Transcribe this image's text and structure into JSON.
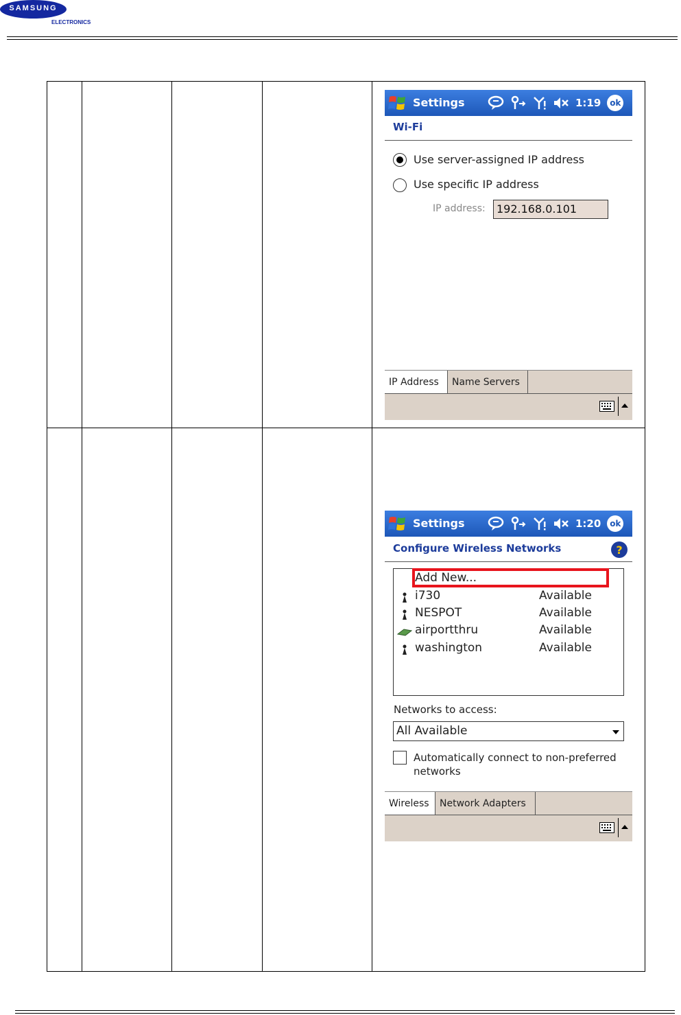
{
  "header": {
    "brand": "SAMSUNG",
    "brand_sub": "ELECTRONICS"
  },
  "status_bar": {
    "icons": [
      "chat-icon",
      "connectivity-icon",
      "signal-icon",
      "speaker-mute-icon"
    ]
  },
  "screen1": {
    "title": "Settings",
    "clock": "1:19",
    "ok_label": "ok",
    "subtitle": "Wi-Fi",
    "radio_server": "Use server-assigned IP address",
    "radio_specific": "Use specific IP address",
    "ip_label": "IP address:",
    "ip_value": "192.168.0.101",
    "tabs": [
      "IP Address",
      "Name Servers"
    ]
  },
  "screen2": {
    "title": "Settings",
    "clock": "1:20",
    "ok_label": "ok",
    "subtitle": "Configure Wireless Networks",
    "help": "?",
    "add_new": "Add New...",
    "networks": [
      {
        "name": "i730",
        "status": "Available",
        "icon": "antenna-icon"
      },
      {
        "name": "NESPOT",
        "status": "Available",
        "icon": "antenna-icon"
      },
      {
        "name": "airportthru",
        "status": "Available",
        "icon": "computer-to-computer-icon"
      },
      {
        "name": "washington",
        "status": "Available",
        "icon": "antenna-icon"
      }
    ],
    "networks_label": "Networks to access:",
    "networks_value": "All Available",
    "auto_connect_line1": "Automatically connect to non-preferred",
    "auto_connect_line2": "networks",
    "tabs": [
      "Wireless",
      "Network Adapters"
    ]
  },
  "colors": {
    "title_bar": "#1d57b8",
    "subtitle": "#1d3c9b",
    "highlight": "#e8141c",
    "tab_bar": "#dcd2c8",
    "logo": "#1428a0"
  }
}
